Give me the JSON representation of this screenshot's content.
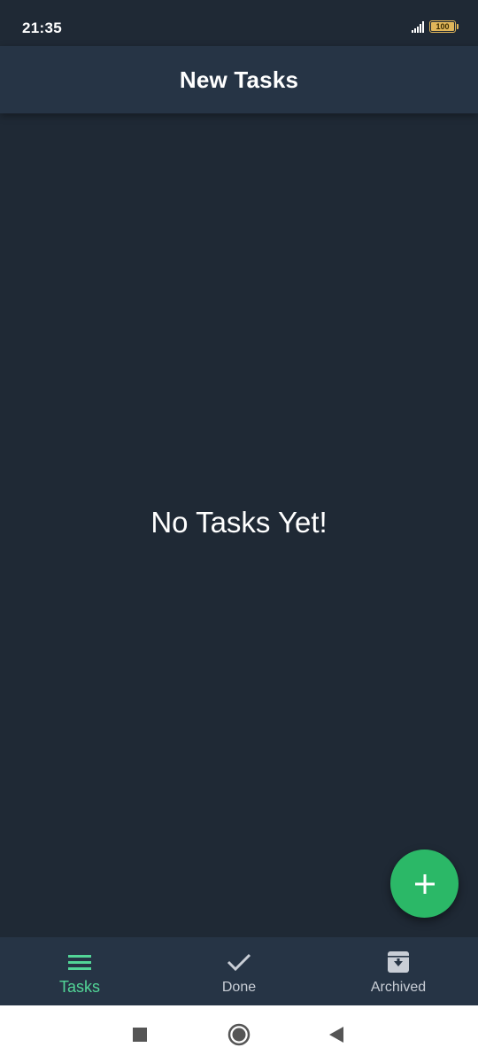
{
  "status_bar": {
    "time": "21:35",
    "battery": "100",
    "icons": [
      "signal-icon",
      "battery-icon"
    ]
  },
  "app_bar": {
    "title": "New Tasks"
  },
  "main": {
    "empty_message": "No Tasks Yet!"
  },
  "fab": {
    "icon": "plus-icon",
    "color": "#2bb867"
  },
  "bottom_nav": {
    "items": [
      {
        "label": "Tasks",
        "icon": "menu-icon",
        "active": true
      },
      {
        "label": "Done",
        "icon": "check-icon",
        "active": false
      },
      {
        "label": "Archived",
        "icon": "archive-icon",
        "active": false
      }
    ],
    "active_color": "#52d597",
    "inactive_color": "#c9ced6"
  },
  "system_nav": {
    "buttons": [
      "recents-square-icon",
      "home-circle-icon",
      "back-triangle-icon"
    ]
  },
  "colors": {
    "background": "#1f2935",
    "app_bar": "#263445",
    "fab": "#2bb867"
  }
}
